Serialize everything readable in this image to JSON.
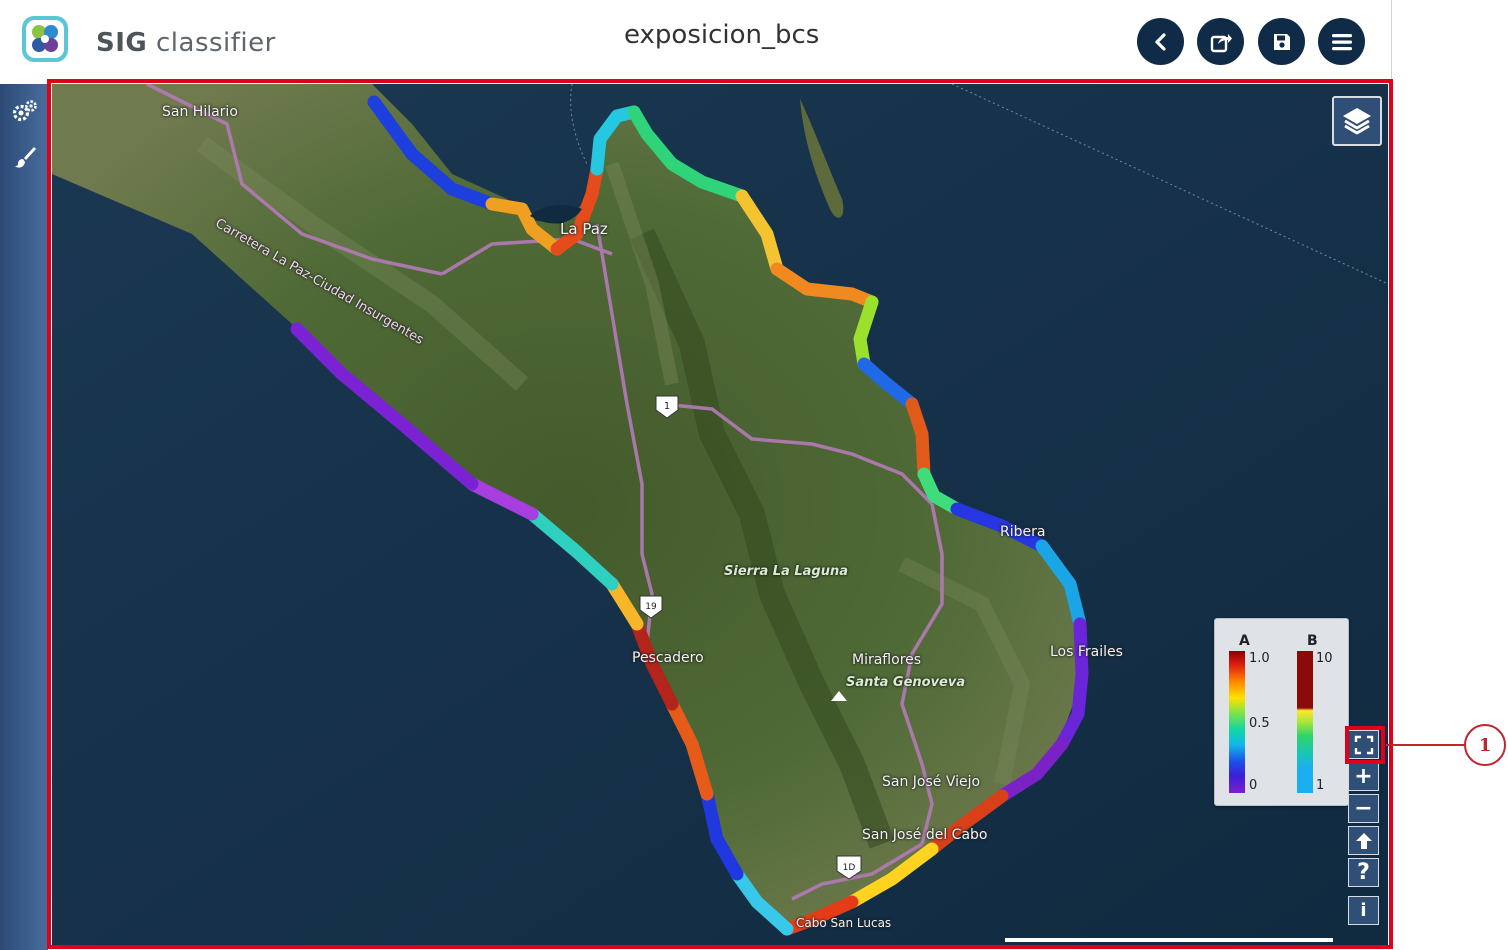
{
  "header": {
    "brand_bold": "SIG",
    "brand_light": "classifier",
    "document_title": "exposicion_bcs",
    "buttons": {
      "back": "back-icon",
      "share": "share-icon",
      "save": "save-icon",
      "menu": "menu-icon"
    }
  },
  "toolstrip": {
    "tools": [
      "settings-gears-icon",
      "paint-brush-icon"
    ]
  },
  "map": {
    "labels": {
      "san_hilario": "San Hilario",
      "carretera": "Carretera La Paz-Ciudad Insurgentes",
      "la_paz": "La Paz",
      "sierra": "Sierra La Laguna",
      "pescadero": "Pescadero",
      "miraflores": "Miraflores",
      "santa_genoveva": "Santa Genoveva",
      "los_frailes": "Los Frailes",
      "ribera": "Ribera",
      "san_jose_viejo": "San José Viejo",
      "san_jose_cabo": "San José del Cabo",
      "cabo_san_lucas": "Cabo San Lucas"
    },
    "road_shields": [
      "1",
      "19",
      "1D"
    ]
  },
  "legend": {
    "a": {
      "title": "A",
      "max": "1.0",
      "mid": "0.5",
      "min": "0"
    },
    "b": {
      "title": "B",
      "max": "10",
      "min": "1"
    }
  },
  "controls": {
    "zoom_in": "+",
    "zoom_out": "−",
    "help": "?",
    "info": "i"
  },
  "callout": {
    "number": "1"
  },
  "colors": {
    "header_button": "#0f2b47",
    "highlight": "#e0001a",
    "callout": "#c0272d",
    "sea": "#15314b",
    "land": "#4d6533"
  }
}
